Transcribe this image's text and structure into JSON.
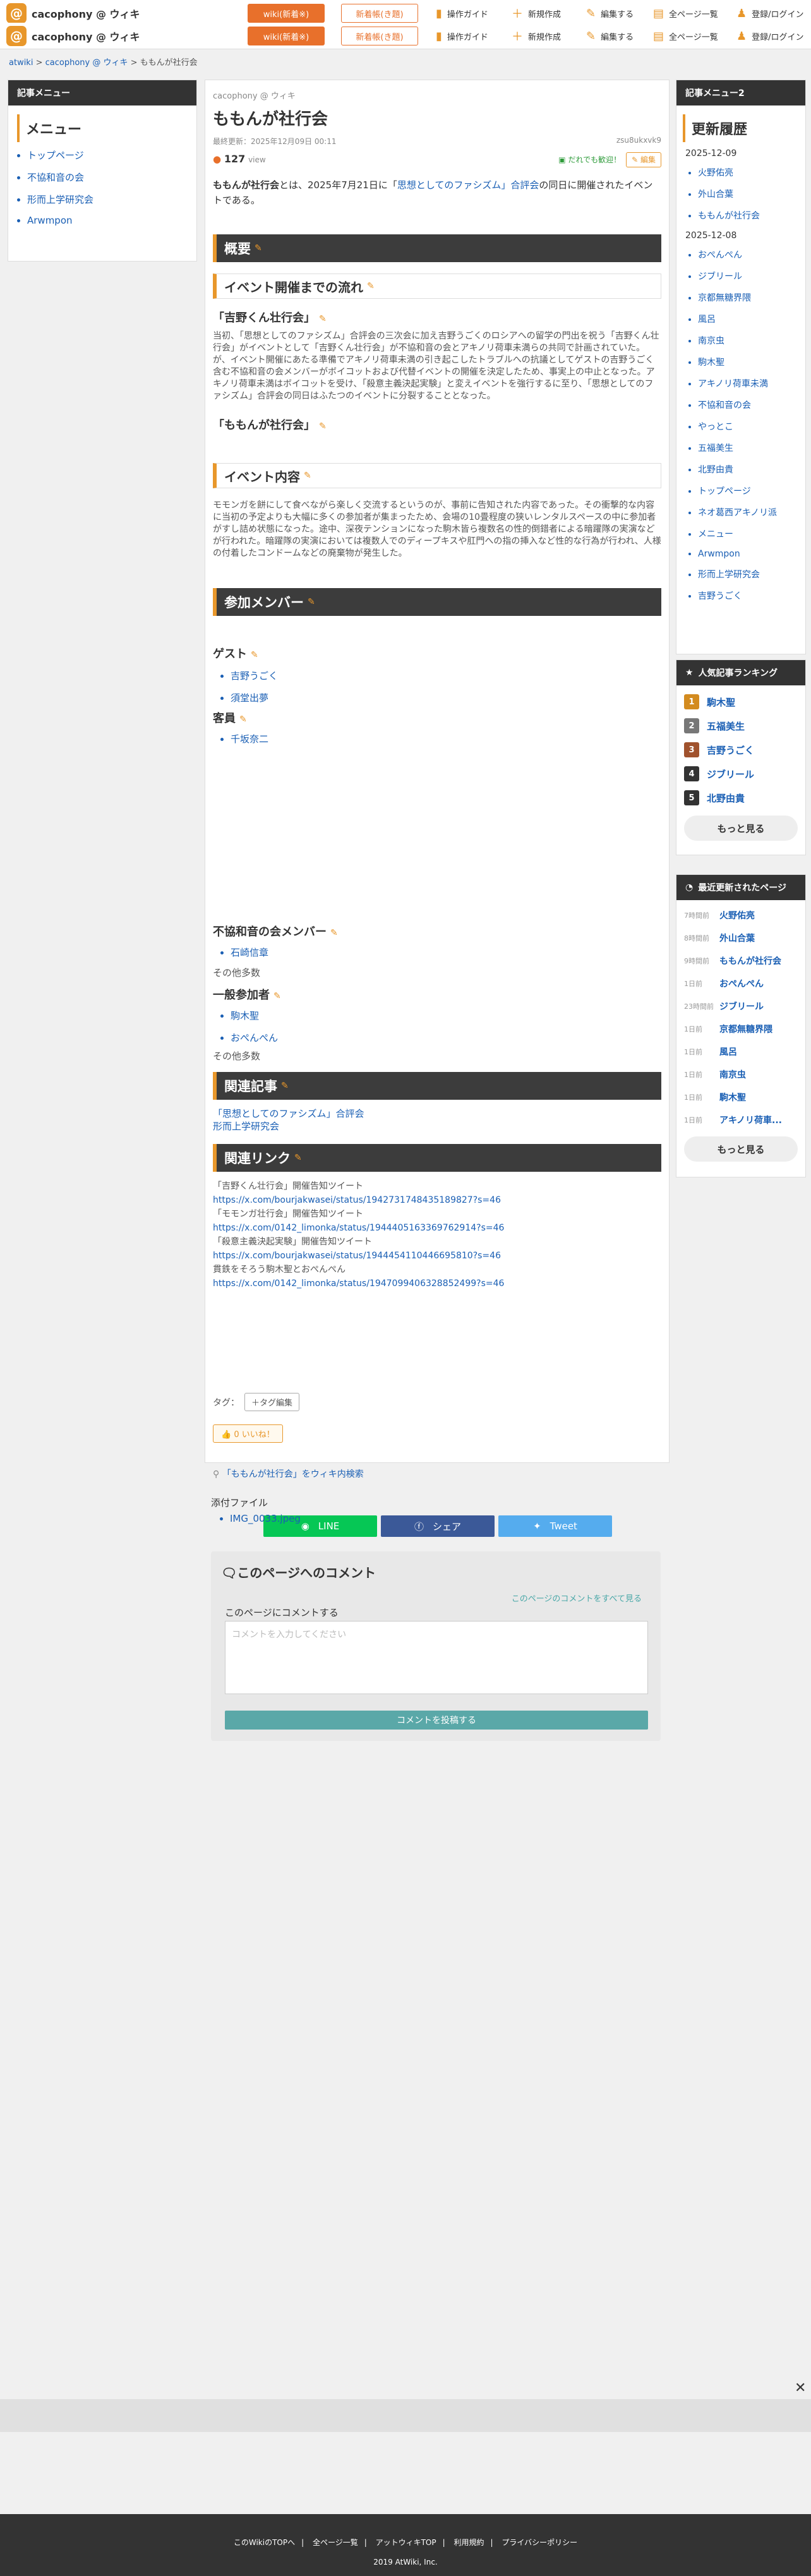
{
  "header": {
    "logo_glyph": "@",
    "site_name": "cacophony @ ウィキ",
    "btn_wiki": "wiki(新着※)",
    "btn_free": "新着帳(き題)",
    "nav": [
      "操作ガイド",
      "新規作成",
      "編集する",
      "全ページ一覧",
      "登録/ログイン"
    ],
    "nav_icons": [
      "guide-icon",
      "plus-icon",
      "edit-icon",
      "list-icon",
      "user-icon"
    ]
  },
  "breadcrumb": [
    "atwiki",
    "cacophony @ ウィキ",
    "ももんが社行会"
  ],
  "left_sidebar": {
    "bar": "記事メニュー",
    "title": "メニュー",
    "items": [
      "トップページ",
      "不協和音の会",
      "形而上学研究会",
      "Arwmpon"
    ]
  },
  "article": {
    "wiki_name": "cacophony @ ウィキ",
    "title": "ももんが社行会",
    "updated": "最終更新：2025年12月09日 00:11",
    "page_user": "zsu8ukxvk9",
    "views": "127",
    "views_unit": "view",
    "invite": "だれでも歓迎！",
    "edit": "編集",
    "intro_bold": "ももんが社行会",
    "intro_mid": "とは、2025年7月21日に「",
    "intro_link": "思想としてのファシズム」合評会",
    "intro_end": "の同日に開催されたイベントである。",
    "h_overview": "概要",
    "h_flow": "イベント開催までの流れ",
    "h_yoshino": "「吉野くん壮行会」",
    "p_flow": "当初、「思想としてのファシズム」合評会の三次会に加え吉野うごくのロシアへの留学の門出を祝う「吉野くん壮行会」がイベントとして「吉野くん壮行会」が不協和音の会とアキノリ荷車未満らの共同で計画されていた。が、イベント開催にあたる準備でアキノリ荷車未満の引き起こしたトラブルへの抗議としてゲストの吉野うごく含む不協和音の会メンバーがボイコットおよび代替イベントの開催を決定したため、事実上の中止となった。アキノリ荷車未満はボイコットを受け、「殺意主義決起実験」と変えイベントを強行するに至り、「思想としてのファシズム」合評会の同日はふたつのイベントに分裂することとなった。",
    "h_momonga": "「ももんが社行会」",
    "h_content": "イベント内容",
    "p_content": "モモンガを餅にして食べながら楽しく交流するというのが、事前に告知された内容であった。その衝撃的な内容に当初の予定よりも大幅に多くの参加者が集まったため、会場の10畳程度の狭いレンタルスペースの中に参加者がすし詰め状態になった。途中、深夜テンションになった駒木皆ら複数名の性的倒錯者による暗躍隊の実演などが行われた。暗躍隊の実演においては複数人でのディープキスや肛門への指の挿入など性的な行為が行われ、人様の付着したコンドームなどの廃棄物が発生した。",
    "h_members": "参加メンバー",
    "h_guest": "ゲスト",
    "guests": [
      "吉野うごく",
      "須堂出夢"
    ],
    "h_kyaku": "客員",
    "kyaku": [
      "千坂奈二"
    ],
    "h_fukyo": "不協和音の会メンバー",
    "fukyo": [
      "石崎信章"
    ],
    "etc1": "その他多数",
    "h_general": "一般参加者",
    "general": [
      "駒木聖",
      "おぺんぺん"
    ],
    "etc2": "その他多数",
    "h_related": "関連記事",
    "related": [
      "「思想としてのファシズム」合評会",
      "形而上学研究会"
    ],
    "h_links": "関連リンク",
    "links": [
      {
        "label": "「吉野くん壮行会」開催告知ツイート",
        "url": "https://x.com/bourjakwasei/status/1942731748435189827?s=46"
      },
      {
        "label": "「モモンガ壮行会」開催告知ツイート",
        "url": "https://x.com/0142_limonka/status/1944405163369762914?s=46"
      },
      {
        "label": "「殺意主義決起実験」開催告知ツイート",
        "url": "https://x.com/bourjakwasei/status/1944454110446695810?s=46"
      },
      {
        "label": "貫鉄をそろう駒木聖とおぺんぺん",
        "url": "https://x.com/0142_limonka/status/1947099406328852499?s=46"
      }
    ],
    "tag_label": "タグ：",
    "tag_edit": "＋タグ編集",
    "like": "0 いいね！",
    "search": "「ももんが社行会」をウィキ内検索",
    "share": [
      "LINE",
      "シェア",
      "Tweet"
    ]
  },
  "attachments": {
    "label": "添付ファイル",
    "files": [
      "IMG_0033.jpeg"
    ]
  },
  "comment": {
    "title": "このページへのコメント",
    "all": "このページのコメントをすべて見る",
    "label": "このページにコメントする",
    "placeholder": "コメントを入力してください",
    "submit": "コメントを投稿する"
  },
  "right_sidebar": {
    "bar": "記事メニュー2",
    "title": "更新履歴",
    "date1": "2025-12-09",
    "list1": [
      "火野佑亮",
      "外山合葉",
      "ももんが社行会"
    ],
    "date2": "2025-12-08",
    "list2": [
      "おぺんぺん",
      "ジブリール",
      "京都無糖界隈",
      "風呂",
      "南京虫",
      "駒木聖",
      "アキノリ荷車未満",
      "不協和音の会",
      "やっとこ",
      "五福美生",
      "北野由貴",
      "トップページ",
      "ネオ葛西アキノリ派",
      "メニュー",
      "Arwmpon",
      "形而上学研究会",
      "吉野うごく"
    ],
    "ranking_bar": "人気記事ランキング",
    "ranking": [
      "駒木聖",
      "五福美生",
      "吉野うごく",
      "ジブリール",
      "北野由貴"
    ],
    "ranking_colors": [
      "#d38b1f",
      "#777777",
      "#a0522d",
      "#333333",
      "#333333"
    ],
    "more": "もっと見る",
    "recent_bar": "最近更新されたページ",
    "recent": [
      {
        "time": "7時間前",
        "name": "火野佑亮"
      },
      {
        "time": "8時間前",
        "name": "外山合葉"
      },
      {
        "time": "9時間前",
        "name": "ももんが社行会"
      },
      {
        "time": "1日前",
        "name": "おぺんぺん"
      },
      {
        "time": "23時間前",
        "name": "ジブリール"
      },
      {
        "time": "1日前",
        "name": "京都無糖界隈"
      },
      {
        "time": "1日前",
        "name": "風呂"
      },
      {
        "time": "1日前",
        "name": "南京虫"
      },
      {
        "time": "1日前",
        "name": "駒木聖"
      },
      {
        "time": "1日前",
        "name": "アキノリ荷車..."
      }
    ],
    "more2": "もっと見る"
  },
  "footer": {
    "links": [
      "このWikiのTOPへ",
      "全ページ一覧",
      "アットウィキTOP",
      "利用規約",
      "プライバシーポリシー"
    ],
    "copyright": "2019 AtWiki, Inc."
  },
  "close_glyph": "✕"
}
